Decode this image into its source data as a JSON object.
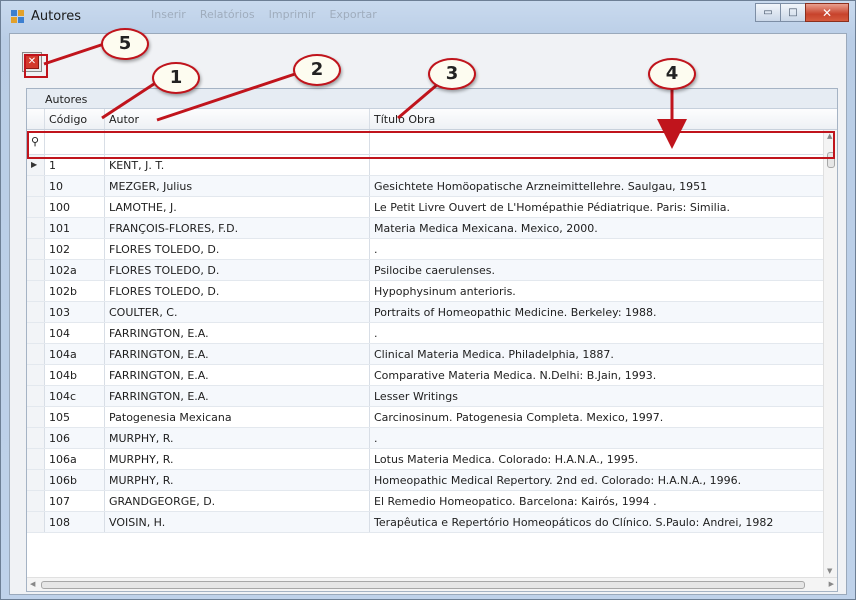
{
  "window": {
    "title": "Autores",
    "ghost_menu": [
      "Inserir",
      "Relatórios",
      "Imprimir",
      "Exportar"
    ],
    "minimize": "▭",
    "maximize": "□",
    "close": "✕"
  },
  "toolbar": {
    "close_label": "✕"
  },
  "panel": {
    "caption": "Autores"
  },
  "grid": {
    "columns": [
      "Código",
      "Autor",
      "Título Obra"
    ],
    "filter_glyph": "⚲",
    "current_row_glyph": "▶",
    "rows": [
      {
        "code": "1",
        "author": "KENT, J. T.",
        "title": ""
      },
      {
        "code": "10",
        "author": "MEZGER, Julius",
        "title": "Gesichtete Homöopatische Arzneimittellehre. Saulgau, 1951"
      },
      {
        "code": "100",
        "author": "LAMOTHE, J.",
        "title": "Le Petit Livre Ouvert de L'Homépathie Pédiatrique. Paris: Similia."
      },
      {
        "code": "101",
        "author": "FRANÇOIS-FLORES, F.D.",
        "title": "Materia Medica Mexicana. Mexico, 2000."
      },
      {
        "code": "102",
        "author": "FLORES TOLEDO, D.",
        "title": "."
      },
      {
        "code": "102a",
        "author": "FLORES TOLEDO, D.",
        "title": "Psilocibe caerulenses."
      },
      {
        "code": "102b",
        "author": "FLORES TOLEDO, D.",
        "title": "Hypophysinum anterioris."
      },
      {
        "code": "103",
        "author": "COULTER, C.",
        "title": "Portraits of Homeopathic Medicine. Berkeley: 1988."
      },
      {
        "code": "104",
        "author": "FARRINGTON, E.A.",
        "title": "."
      },
      {
        "code": "104a",
        "author": "FARRINGTON, E.A.",
        "title": "Clinical Materia Medica. Philadelphia, 1887."
      },
      {
        "code": "104b",
        "author": "FARRINGTON, E.A.",
        "title": "Comparative Materia Medica. N.Delhi: B.Jain, 1993."
      },
      {
        "code": "104c",
        "author": "FARRINGTON, E.A.",
        "title": "Lesser Writings"
      },
      {
        "code": "105",
        "author": "Patogenesia Mexicana",
        "title": "Carcinosinum. Patogenesia Completa. Mexico, 1997."
      },
      {
        "code": "106",
        "author": "MURPHY, R.",
        "title": "."
      },
      {
        "code": "106a",
        "author": "MURPHY, R.",
        "title": "Lotus Materia Medica. Colorado: H.A.N.A., 1995."
      },
      {
        "code": "106b",
        "author": "MURPHY, R.",
        "title": "Homeopathic Medical Repertory. 2nd ed. Colorado: H.A.N.A., 1996."
      },
      {
        "code": "107",
        "author": "GRANDGEORGE, D.",
        "title": "El Remedio Homeopatico. Barcelona: Kairós, 1994 ."
      },
      {
        "code": "108",
        "author": "VOISIN, H.",
        "title": "Terapêutica e Repertório Homeopáticos do Clínico. S.Paulo: Andrei, 1982"
      }
    ]
  },
  "callouts": [
    "1",
    "2",
    "3",
    "4",
    "5"
  ],
  "colors": {
    "annotation": "#c0141c",
    "callout_fill": "#fdfcf0"
  }
}
